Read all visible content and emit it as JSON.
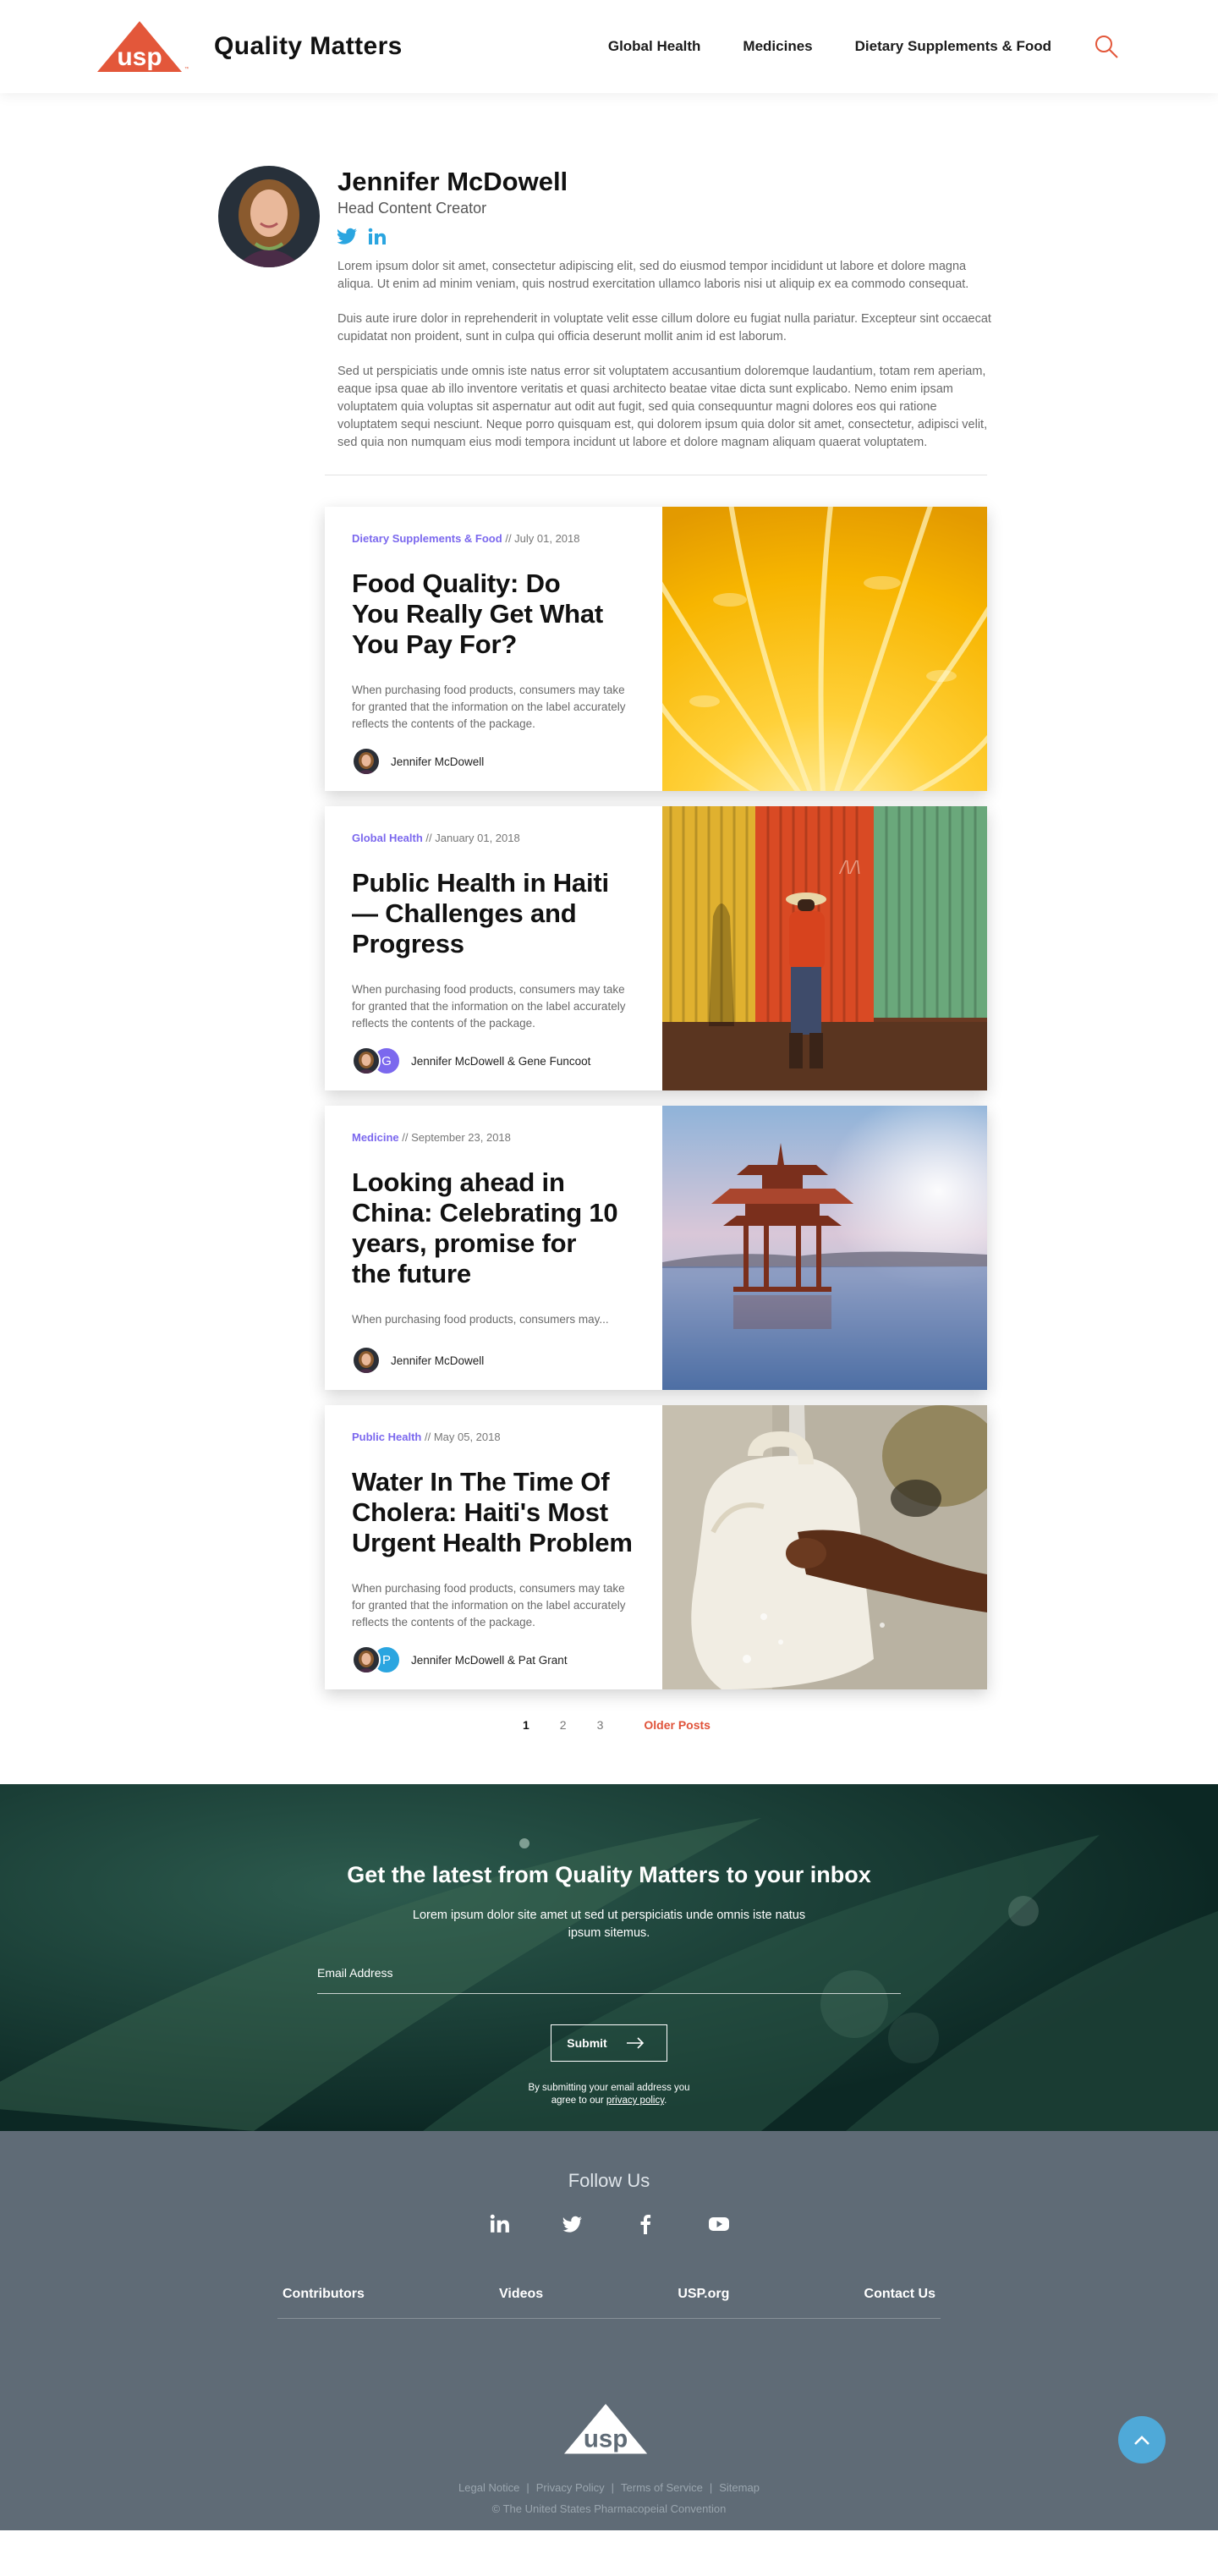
{
  "header": {
    "logo_text": "usp",
    "site_title": "Quality Matters",
    "nav": [
      "Global Health",
      "Medicines",
      "Dietary Supplements & Food"
    ]
  },
  "author": {
    "name": "Jennifer McDowell",
    "role": "Head Content Creator",
    "bio": [
      "Lorem ipsum dolor sit amet, consectetur adipiscing elit, sed do eiusmod tempor incididunt ut labore et dolore magna aliqua. Ut enim ad minim veniam, quis nostrud exercitation ullamco laboris nisi ut aliquip ex ea commodo consequat.",
      "Duis aute irure dolor in reprehenderit in voluptate velit esse cillum dolore eu fugiat nulla pariatur. Excepteur sint occaecat cupidatat non proident, sunt in culpa qui officia deserunt mollit anim id est laborum.",
      "Sed ut perspiciatis unde omnis iste natus error sit voluptatem accusantium doloremque laudantium, totam rem aperiam, eaque ipsa quae ab illo inventore veritatis et quasi architecto beatae vitae dicta sunt explicabo. Nemo enim ipsam voluptatem quia voluptas sit aspernatur aut odit aut fugit, sed quia consequuntur magni dolores eos qui ratione voluptatem sequi nesciunt. Neque porro quisquam est, qui dolorem ipsum quia dolor sit amet, consectetur, adipisci velit, sed quia non numquam eius modi tempora incidunt ut labore et dolore magnam aliquam quaerat voluptatem."
    ]
  },
  "articles": [
    {
      "category": "Dietary Supplements & Food",
      "date": "// July 01, 2018",
      "title": "Food Quality: Do You Really Get What You Pay For?",
      "excerpt": "When purchasing food products, consumers may take for granted that the information on the label accurately reflects the contents of the package.",
      "authors": "Jennifer McDowell",
      "second_initial": ""
    },
    {
      "category": "Global Health",
      "date": "// January 01, 2018",
      "title": "Public Health in Haiti — Challenges and Progress",
      "excerpt": "When purchasing food products, consumers may take for granted that the information on the label accurately reflects the contents of the package.",
      "authors": "Jennifer McDowell & Gene Funcoot",
      "second_initial": "G"
    },
    {
      "category": "Medicine",
      "date": "// September 23, 2018",
      "title": "Looking ahead in China: Celebrating 10 years, promise for the future",
      "excerpt": "When purchasing food products, consumers may...",
      "authors": "Jennifer McDowell",
      "second_initial": ""
    },
    {
      "category": "Public Health",
      "date": "// May 05, 2018",
      "title": "Water In The Time Of Cholera: Haiti's Most Urgent Health Problem",
      "excerpt": "When purchasing food products, consumers may take for granted that the information on the label accurately reflects the contents of the package.",
      "authors": "Jennifer McDowell & Pat Grant",
      "second_initial": "P"
    }
  ],
  "pagination": {
    "pages": [
      "1",
      "2",
      "3"
    ],
    "older": "Older Posts"
  },
  "newsletter": {
    "title": "Get the latest from Quality Matters to your inbox",
    "subtitle": "Lorem ipsum dolor site amet ut sed ut perspiciatis unde omnis iste natus ipsum sitemus.",
    "email_label": "Email Address",
    "submit": "Submit",
    "note_line1": "By submitting your email address you",
    "note_line2_prefix": "agree to our ",
    "note_link": "privacy policy",
    "note_suffix": "."
  },
  "footer": {
    "follow": "Follow Us",
    "links": [
      "Contributors",
      "Videos",
      "USP.org",
      "Contact Us"
    ],
    "legal": [
      "Legal Notice",
      "Privacy Policy",
      "Terms of Service",
      "Sitemap"
    ],
    "copyright": "© The United States Pharmacopeial Convention"
  },
  "colors": {
    "brand_orange": "#e3573a",
    "category_purple": "#7b68ee",
    "social_blue": "#2aa5e0",
    "newsletter_bg": "#0f2f2b",
    "footer_bg": "#5f6b76",
    "to_top": "#4fa9d8"
  },
  "icons": [
    "usp-logo",
    "search-icon",
    "twitter-icon",
    "linkedin-icon",
    "facebook-icon",
    "youtube-icon",
    "arrow-right-icon",
    "chevron-up-icon"
  ]
}
